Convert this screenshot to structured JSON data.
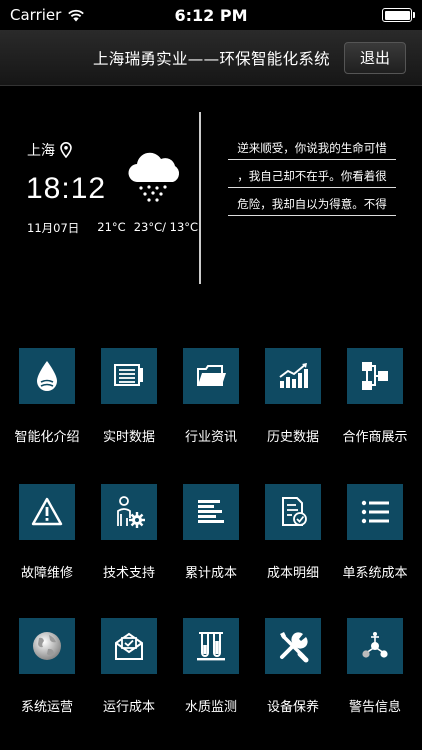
{
  "status_bar": {
    "carrier": "Carrier",
    "time": "6:12 PM"
  },
  "header": {
    "title": "上海瑞勇实业——环保智能化系统",
    "logout_label": "退出"
  },
  "weather": {
    "city": "上海",
    "time": "18:12",
    "date": "11月07日",
    "current_temp": "21°C",
    "temp_range": "23°C/ 13°C",
    "condition_icon": "rain-cloud-icon"
  },
  "quote": {
    "lines": [
      "逆来顺受，你说我的生命可惜",
      "，我自己却不在乎。你看着很",
      "危险，我却自以为得意。不得"
    ]
  },
  "menu": {
    "items": [
      {
        "label": "智能化介绍",
        "icon": "water-drop-icon"
      },
      {
        "label": "实时数据",
        "icon": "monitor-icon"
      },
      {
        "label": "行业资讯",
        "icon": "folder-icon"
      },
      {
        "label": "历史数据",
        "icon": "chart-icon"
      },
      {
        "label": "合作商展示",
        "icon": "flowchart-icon"
      },
      {
        "label": "故障维修",
        "icon": "warning-icon"
      },
      {
        "label": "技术支持",
        "icon": "technician-icon"
      },
      {
        "label": "累计成本",
        "icon": "text-lines-icon"
      },
      {
        "label": "成本明细",
        "icon": "document-check-icon"
      },
      {
        "label": "单系统成本",
        "icon": "list-icon"
      },
      {
        "label": "系统运营",
        "icon": "globe-icon"
      },
      {
        "label": "运行成本",
        "icon": "envelope-icon"
      },
      {
        "label": "水质监测",
        "icon": "test-tubes-icon"
      },
      {
        "label": "设备保养",
        "icon": "tools-icon"
      },
      {
        "label": "警告信息",
        "icon": "network-icon"
      }
    ]
  },
  "colors": {
    "tile": "#0f4a62",
    "background": "#000000",
    "header": "#202020"
  }
}
